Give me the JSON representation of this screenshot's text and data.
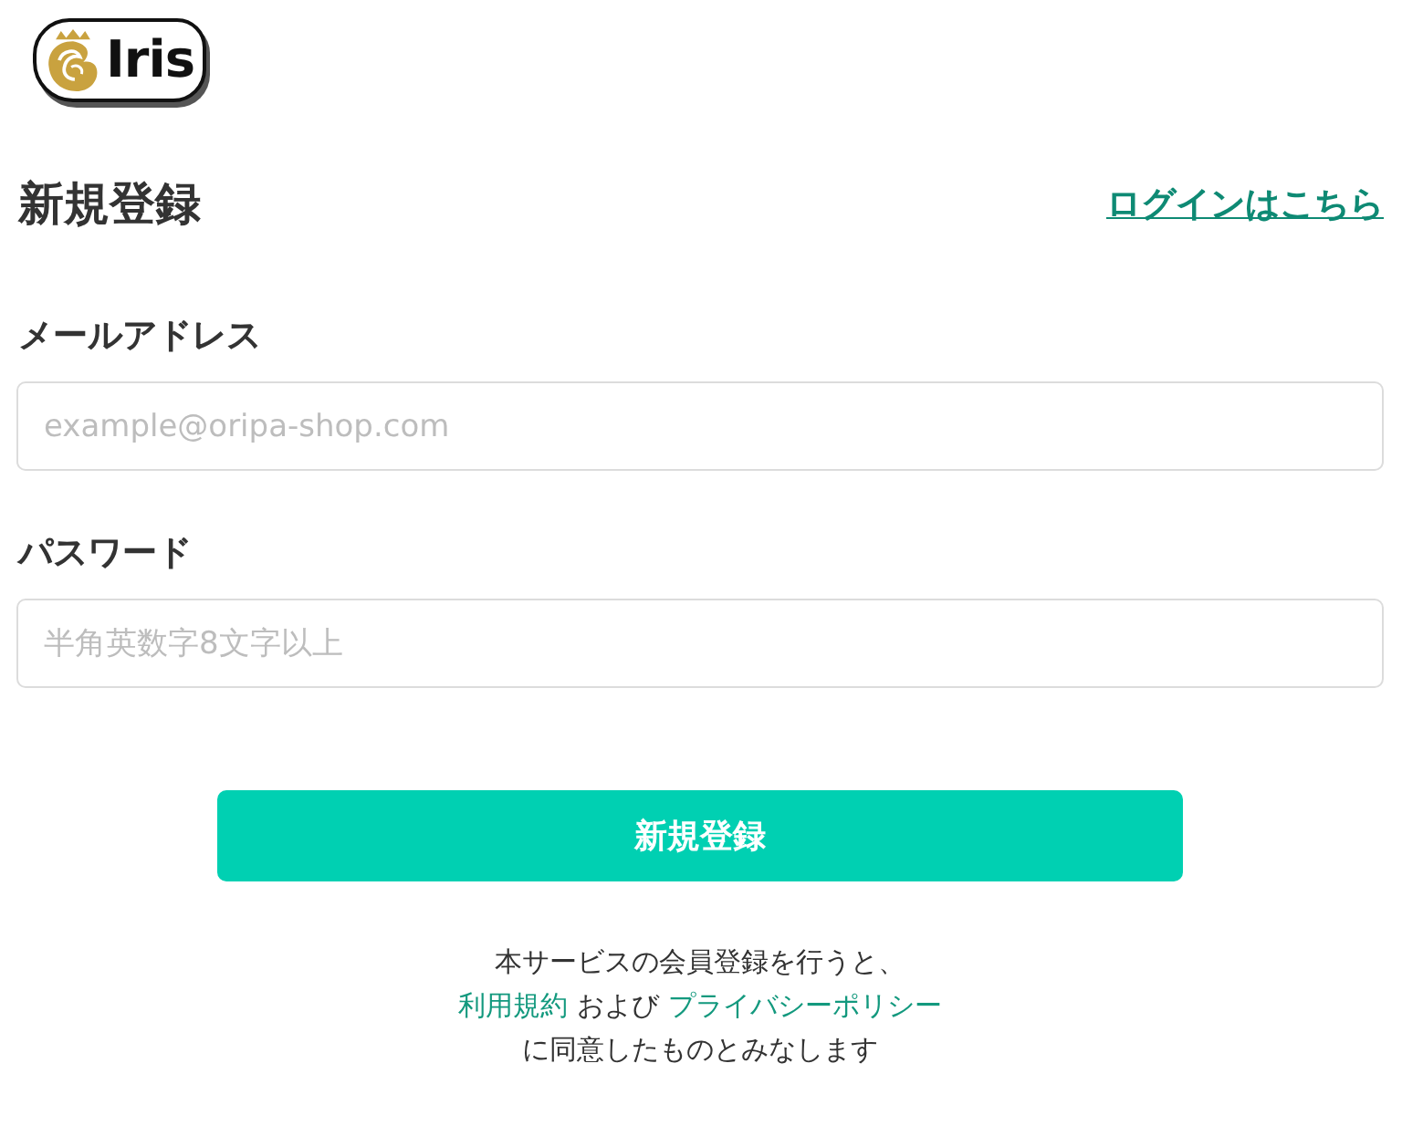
{
  "logo": {
    "text": "Iris"
  },
  "header": {
    "title": "新規登録",
    "login_link": "ログインはこちら"
  },
  "fields": [
    {
      "label": "メールアドレス",
      "placeholder": "example@oripa-shop.com"
    },
    {
      "label": "パスワード",
      "placeholder": "半角英数字8文字以上"
    }
  ],
  "submit_button": "新規登録",
  "notice": {
    "line_1": "本サービスの会員登録を行うと、",
    "terms_link": "利用規約",
    "conjunction": "および",
    "privacy_link": "プライバシーポリシー",
    "line_3": "に同意したものとみなします"
  }
}
